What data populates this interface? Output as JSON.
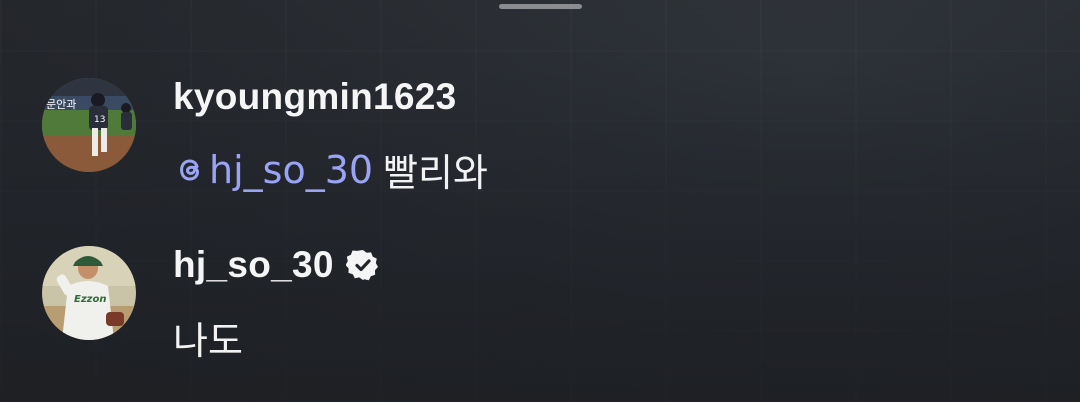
{
  "comments": [
    {
      "username": "kyoungmin1623",
      "verified": false,
      "mention": "hj_so_30",
      "text": "빨리와",
      "avatar_icon": "baseball-player-photo"
    },
    {
      "username": "hj_so_30",
      "verified": true,
      "text": "나도",
      "avatar_icon": "pitcher-photo"
    }
  ],
  "colors": {
    "background": "#23252a",
    "username": "#f5f5f5",
    "text": "#f2f2f2",
    "mention": "#9aa4f5"
  }
}
